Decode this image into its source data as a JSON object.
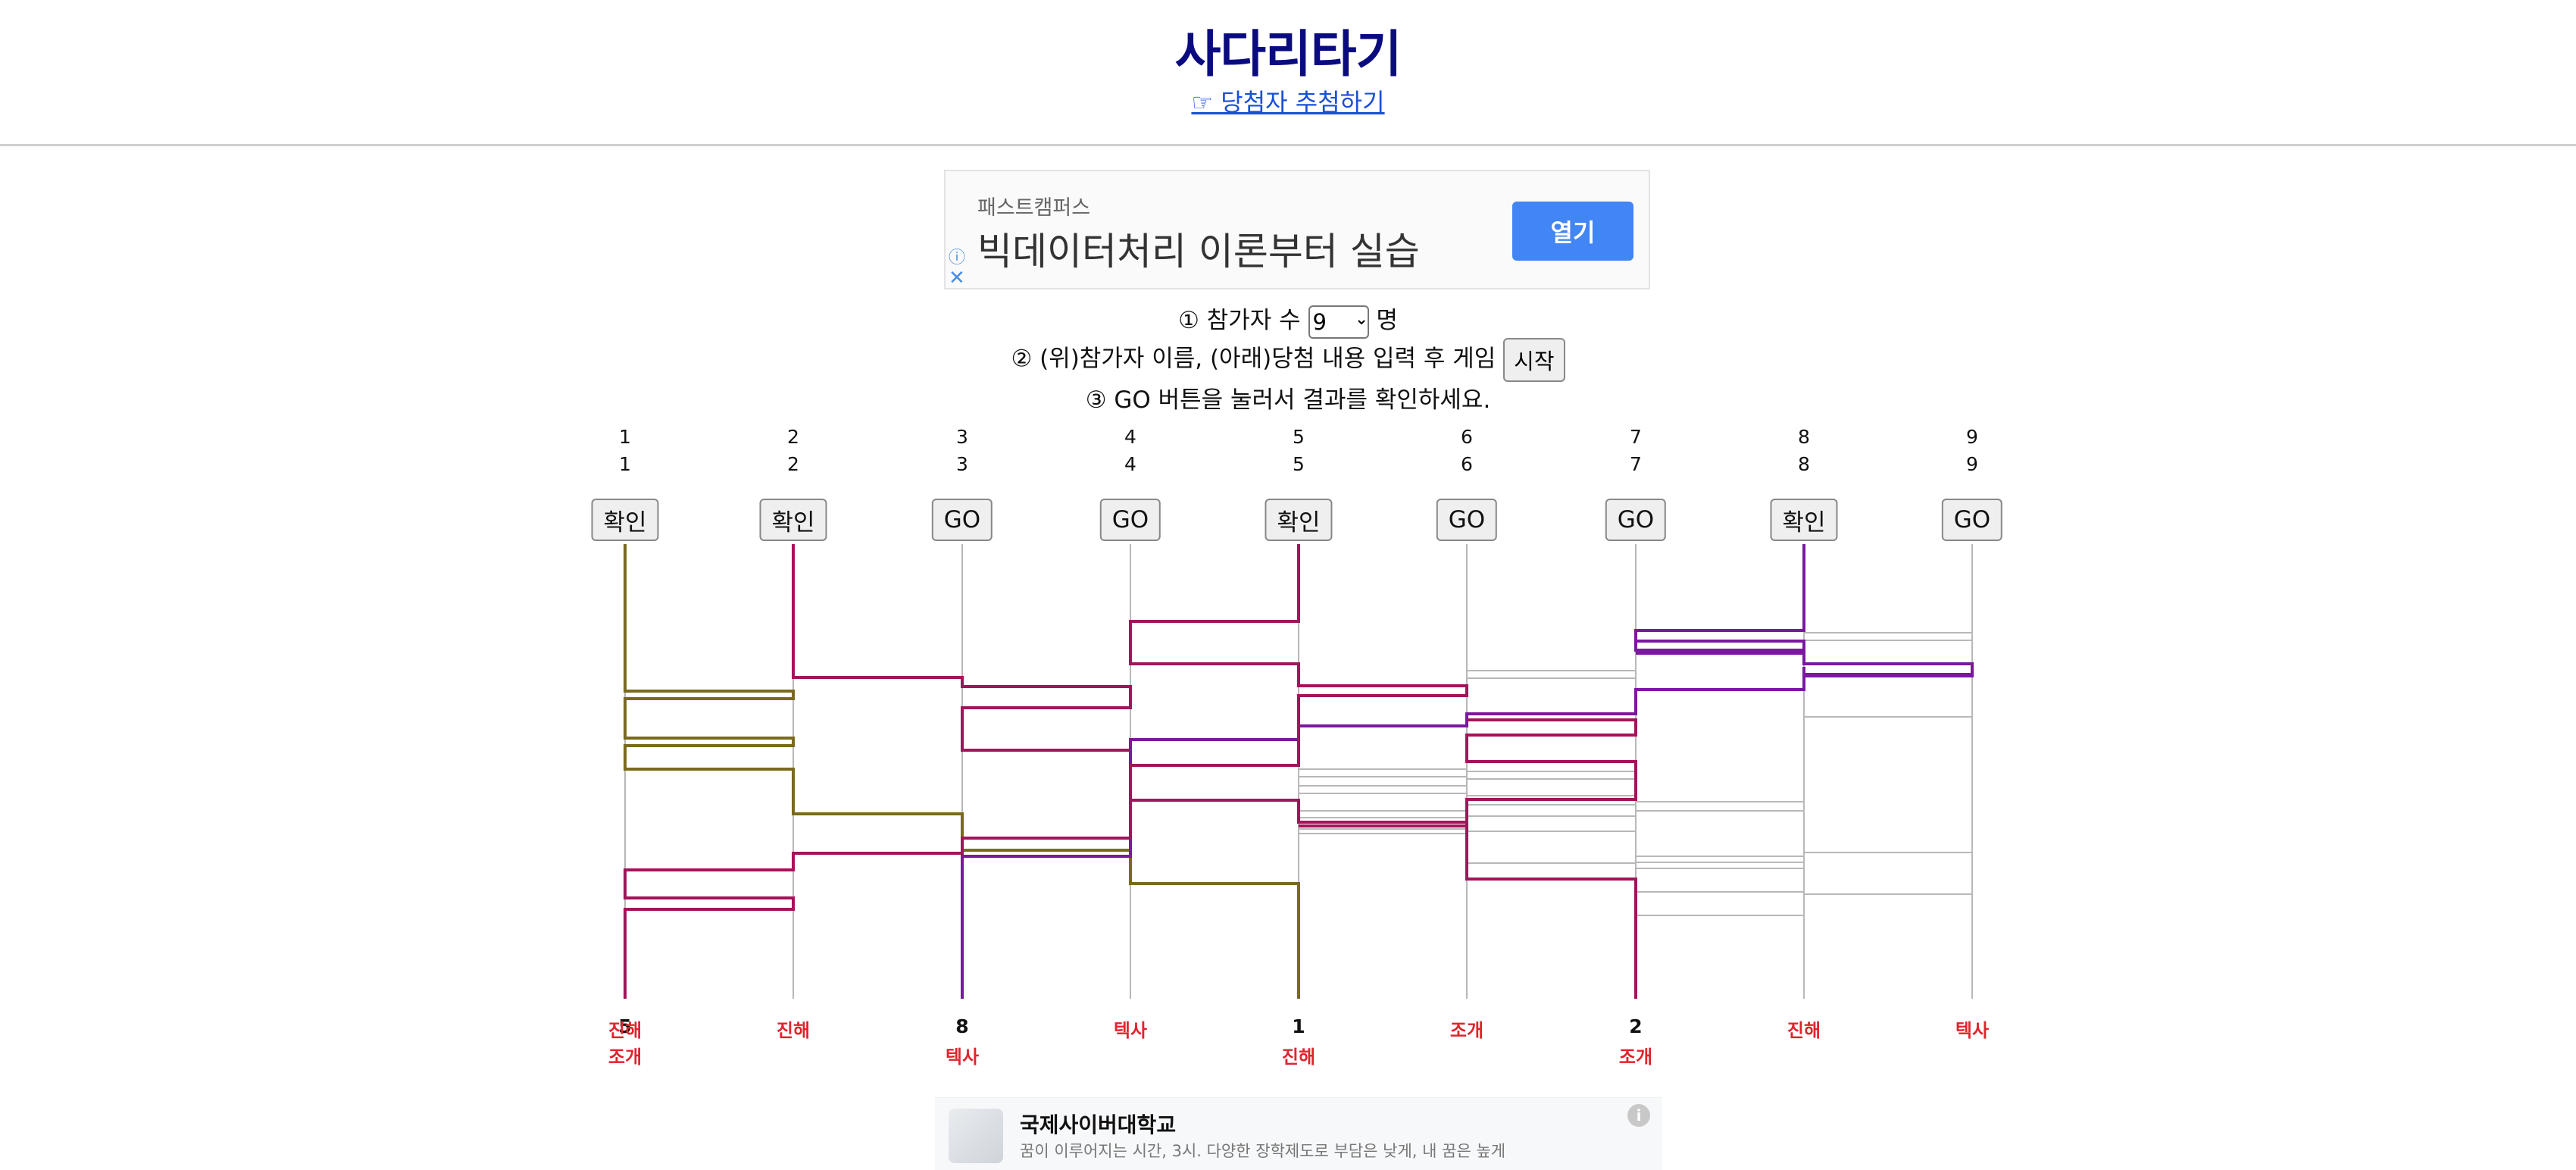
{
  "header": {
    "title": "사다리타기",
    "link_label": "☞ 당첨자 추첨하기"
  },
  "ad_top": {
    "advertiser": "패스트캠퍼스",
    "headline": "빅데이터처리 이론부터 실습",
    "button_label": "열기",
    "info_icon": "ⓘ",
    "close_icon": "✕"
  },
  "instructions": {
    "step1_prefix": "① 참가자 수",
    "step1_suffix": "명",
    "participant_count": "9",
    "step2_text": "② (위)참가자 이름, (아래)당첨 내용 입력 후 게임",
    "start_label": "시작",
    "step3_text": "③ GO 버튼을 눌러서 결과를 확인하세요."
  },
  "ladder": {
    "participants": [
      {
        "name": "1",
        "name2": "1",
        "button": "확인",
        "prize": "진해",
        "result_num": "5",
        "result_prize": "조개"
      },
      {
        "name": "2",
        "name2": "2",
        "button": "확인",
        "prize": "진해",
        "result_num": "",
        "result_prize": ""
      },
      {
        "name": "3",
        "name2": "3",
        "button": "GO",
        "prize": "",
        "result_num": "8",
        "result_prize": "텍사"
      },
      {
        "name": "4",
        "name2": "4",
        "button": "GO",
        "prize": "텍사",
        "result_num": "",
        "result_prize": ""
      },
      {
        "name": "5",
        "name2": "5",
        "button": "확인",
        "prize": "",
        "result_num": "1",
        "result_prize": "진해"
      },
      {
        "name": "6",
        "name2": "6",
        "button": "GO",
        "prize": "조개",
        "result_num": "",
        "result_prize": ""
      },
      {
        "name": "7",
        "name2": "7",
        "button": "GO",
        "prize": "",
        "result_num": "2",
        "result_prize": "조개"
      },
      {
        "name": "8",
        "name2": "8",
        "button": "확인",
        "prize": "진해",
        "result_num": "",
        "result_prize": ""
      },
      {
        "name": "9",
        "name2": "9",
        "button": "GO",
        "prize": "텍사",
        "result_num": "",
        "result_prize": ""
      }
    ],
    "colors": {
      "olive": "#7a6a1c",
      "crimson": "#a3145a",
      "purple": "#7a18a0",
      "rail": "#b8b8b8",
      "prize_red": "#e0242d"
    }
  },
  "ad_bottom": {
    "name": "국제사이버대학교",
    "description": "꿈이 이루어지는 시간, 3시. 다양한 장학제도로 부담은 낮게, 내 꿈은 높게",
    "info_icon": "i"
  }
}
